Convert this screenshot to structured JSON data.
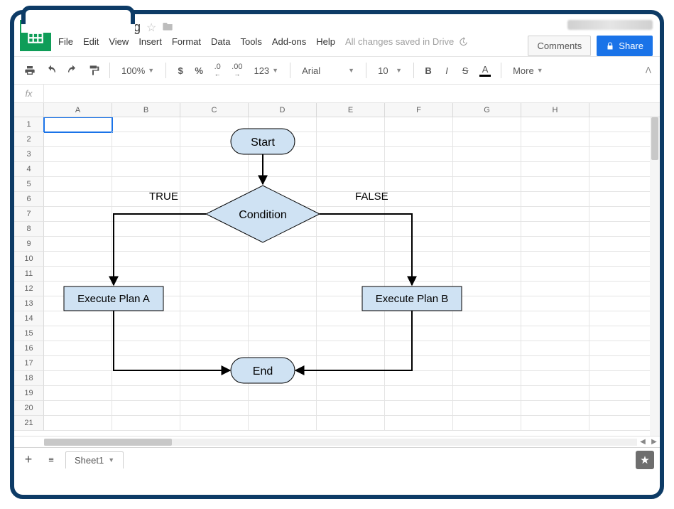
{
  "document": {
    "title": "Insert Drawing",
    "save_status": "All changes saved in Drive"
  },
  "menus": {
    "file": "File",
    "edit": "Edit",
    "view": "View",
    "insert": "Insert",
    "format": "Format",
    "data": "Data",
    "tools": "Tools",
    "addons": "Add-ons",
    "help": "Help"
  },
  "header_buttons": {
    "comments": "Comments",
    "share": "Share"
  },
  "toolbar": {
    "zoom": "100%",
    "currency": "$",
    "percent": "%",
    "dec_dec": ".0",
    "inc_dec": ".00",
    "num_format": "123",
    "font": "Arial",
    "font_size": "10",
    "more": "More"
  },
  "formula_bar": {
    "fx": "fx",
    "value": ""
  },
  "grid": {
    "columns": [
      "A",
      "B",
      "C",
      "D",
      "E",
      "F",
      "G",
      "H"
    ],
    "row_count": 21,
    "selected_cell": "A1"
  },
  "flowchart": {
    "start": "Start",
    "condition": "Condition",
    "true_label": "TRUE",
    "false_label": "FALSE",
    "plan_a": "Execute Plan A",
    "plan_b": "Execute Plan B",
    "end": "End"
  },
  "sheets": {
    "tab1": "Sheet1"
  }
}
